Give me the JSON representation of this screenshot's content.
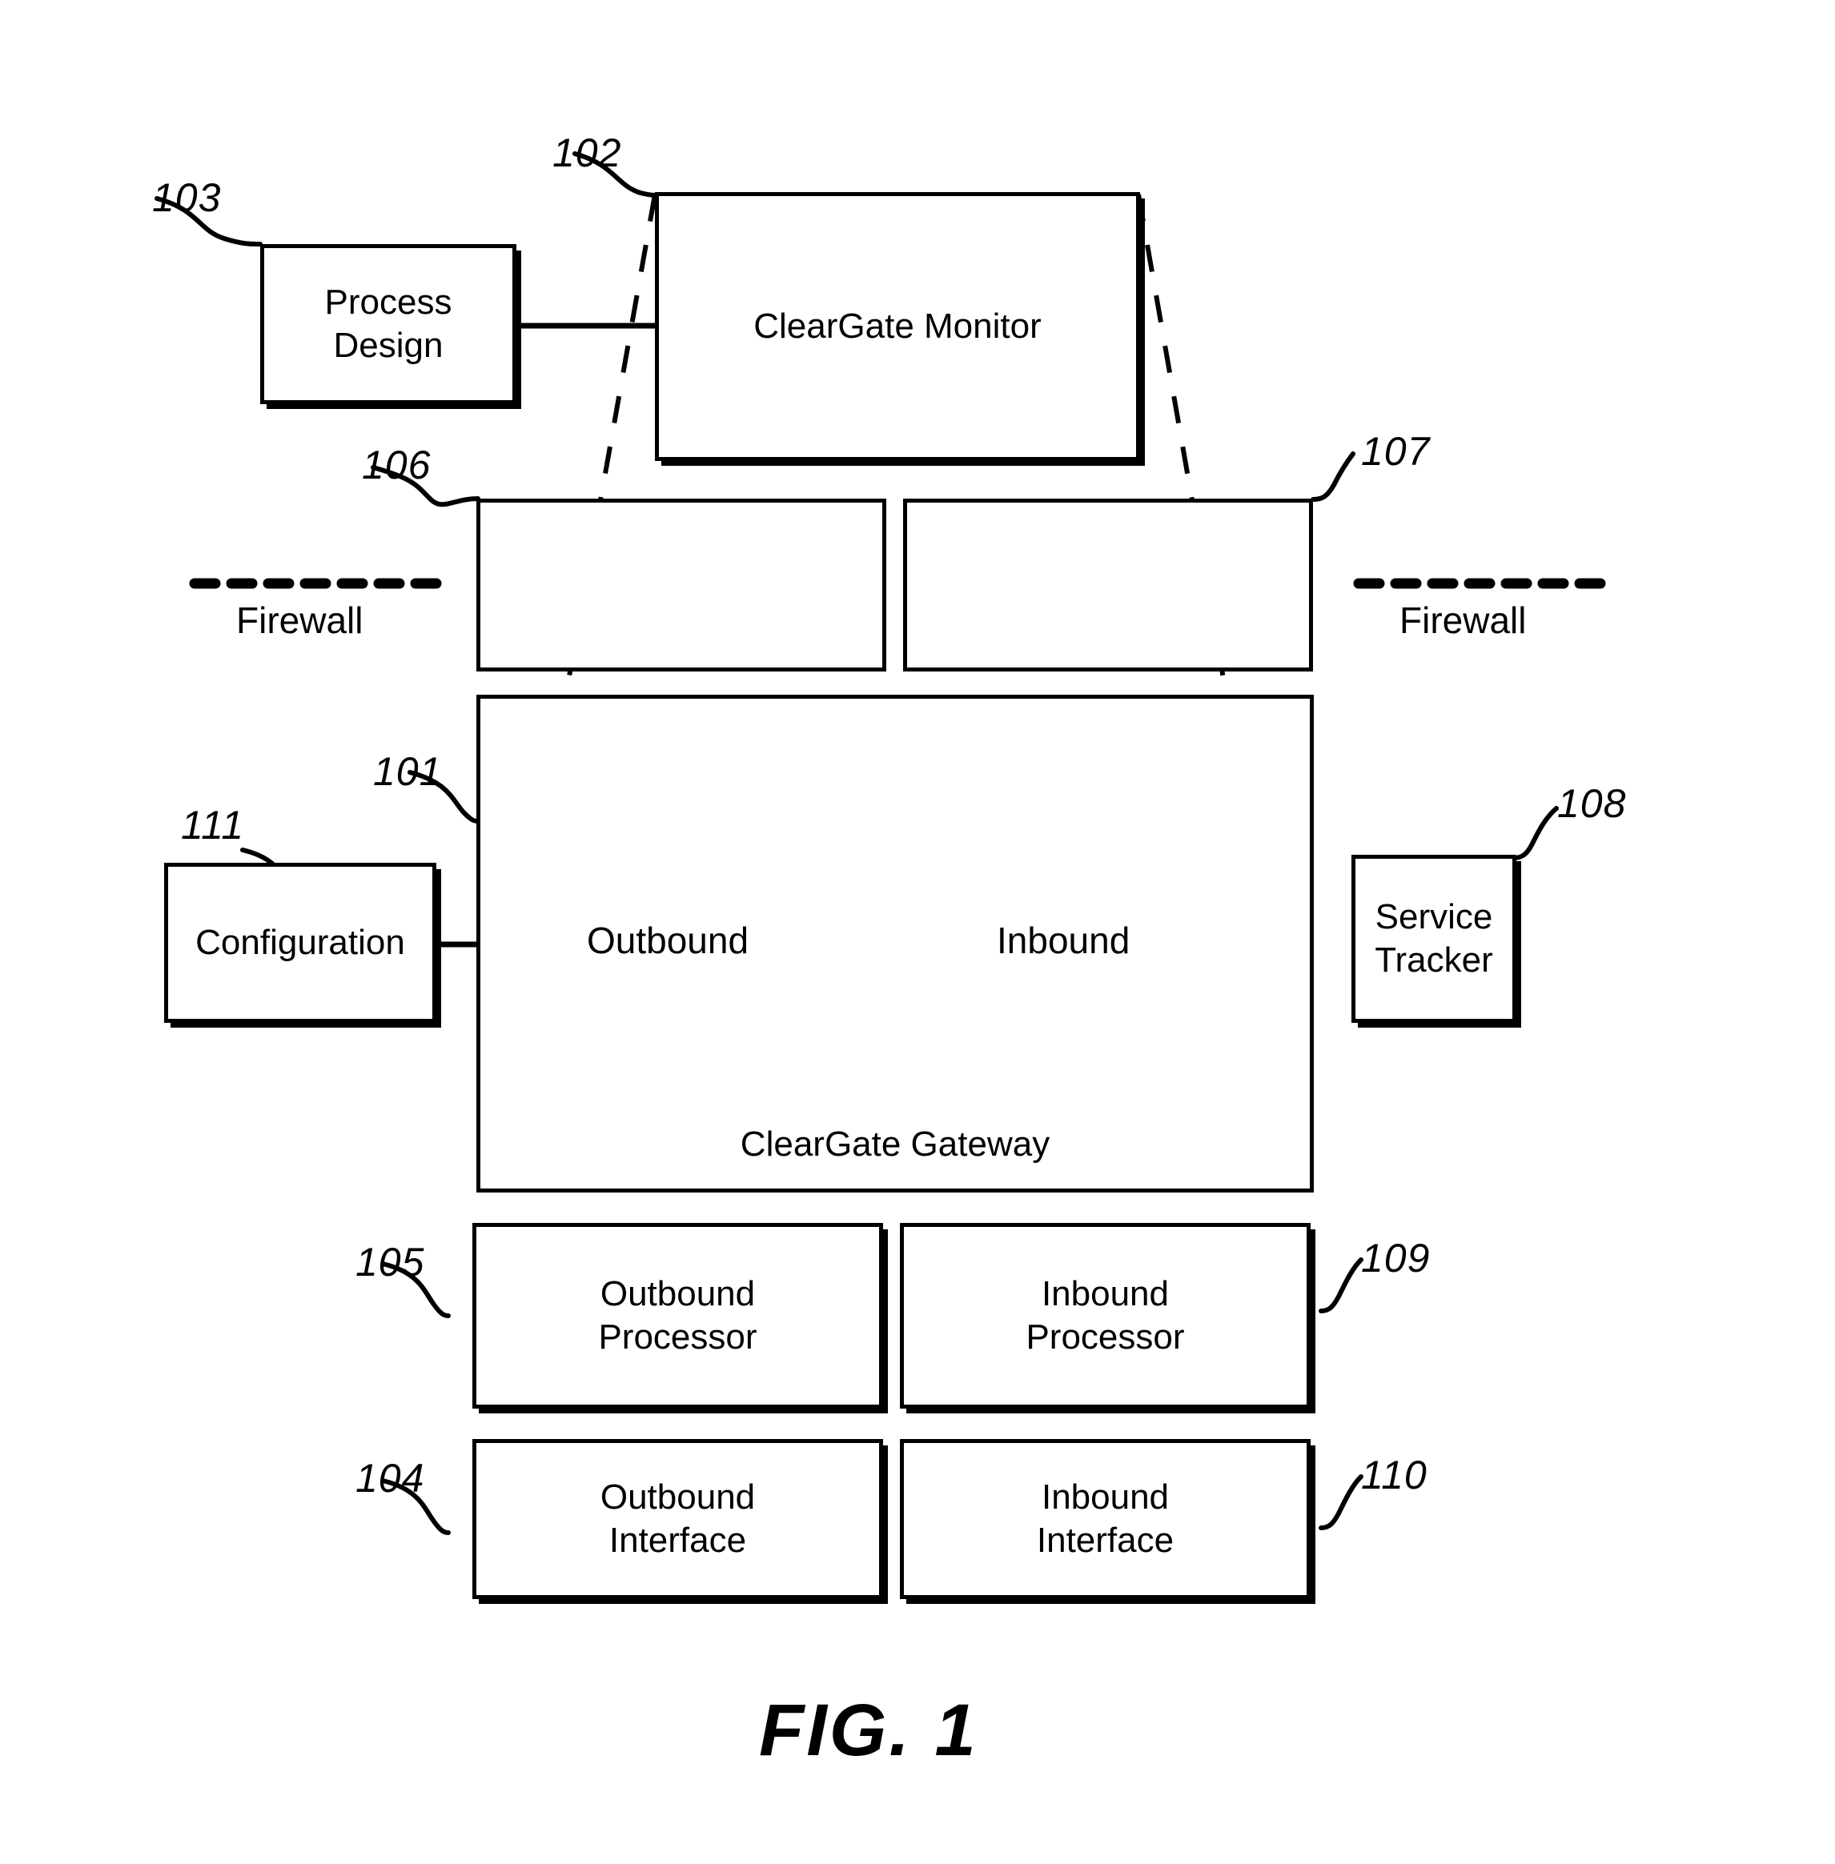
{
  "figure": {
    "caption": "FIG. 1",
    "boxes": {
      "process_design": "Process\nDesign",
      "cleargate_monitor": "ClearGate Monitor",
      "zone_outbound": "",
      "zone_inbound": "",
      "configuration": "Configuration",
      "service_tracker": "Service\nTracker",
      "cleargate_gateway": "ClearGate Gateway",
      "outbound_processor": "Outbound\nProcessor",
      "inbound_processor": "Inbound\nProcessor",
      "outbound_interface": "Outbound\nInterface",
      "inbound_interface": "Inbound\nInterface"
    },
    "flow_labels": {
      "outbound": "Outbound",
      "inbound": "Inbound"
    },
    "firewall_labels": {
      "left": "Firewall",
      "right": "Firewall"
    },
    "reference_numerals": {
      "gateway": "101",
      "monitor": "102",
      "process_design": "103",
      "outbound_interface": "104",
      "outbound_processor": "105",
      "dmz_left": "106",
      "dmz_right": "107",
      "service_tracker": "108",
      "inbound_processor": "109",
      "inbound_interface": "110",
      "configuration": "111"
    },
    "colors": {
      "stroke": "#000000",
      "background": "#ffffff"
    }
  }
}
